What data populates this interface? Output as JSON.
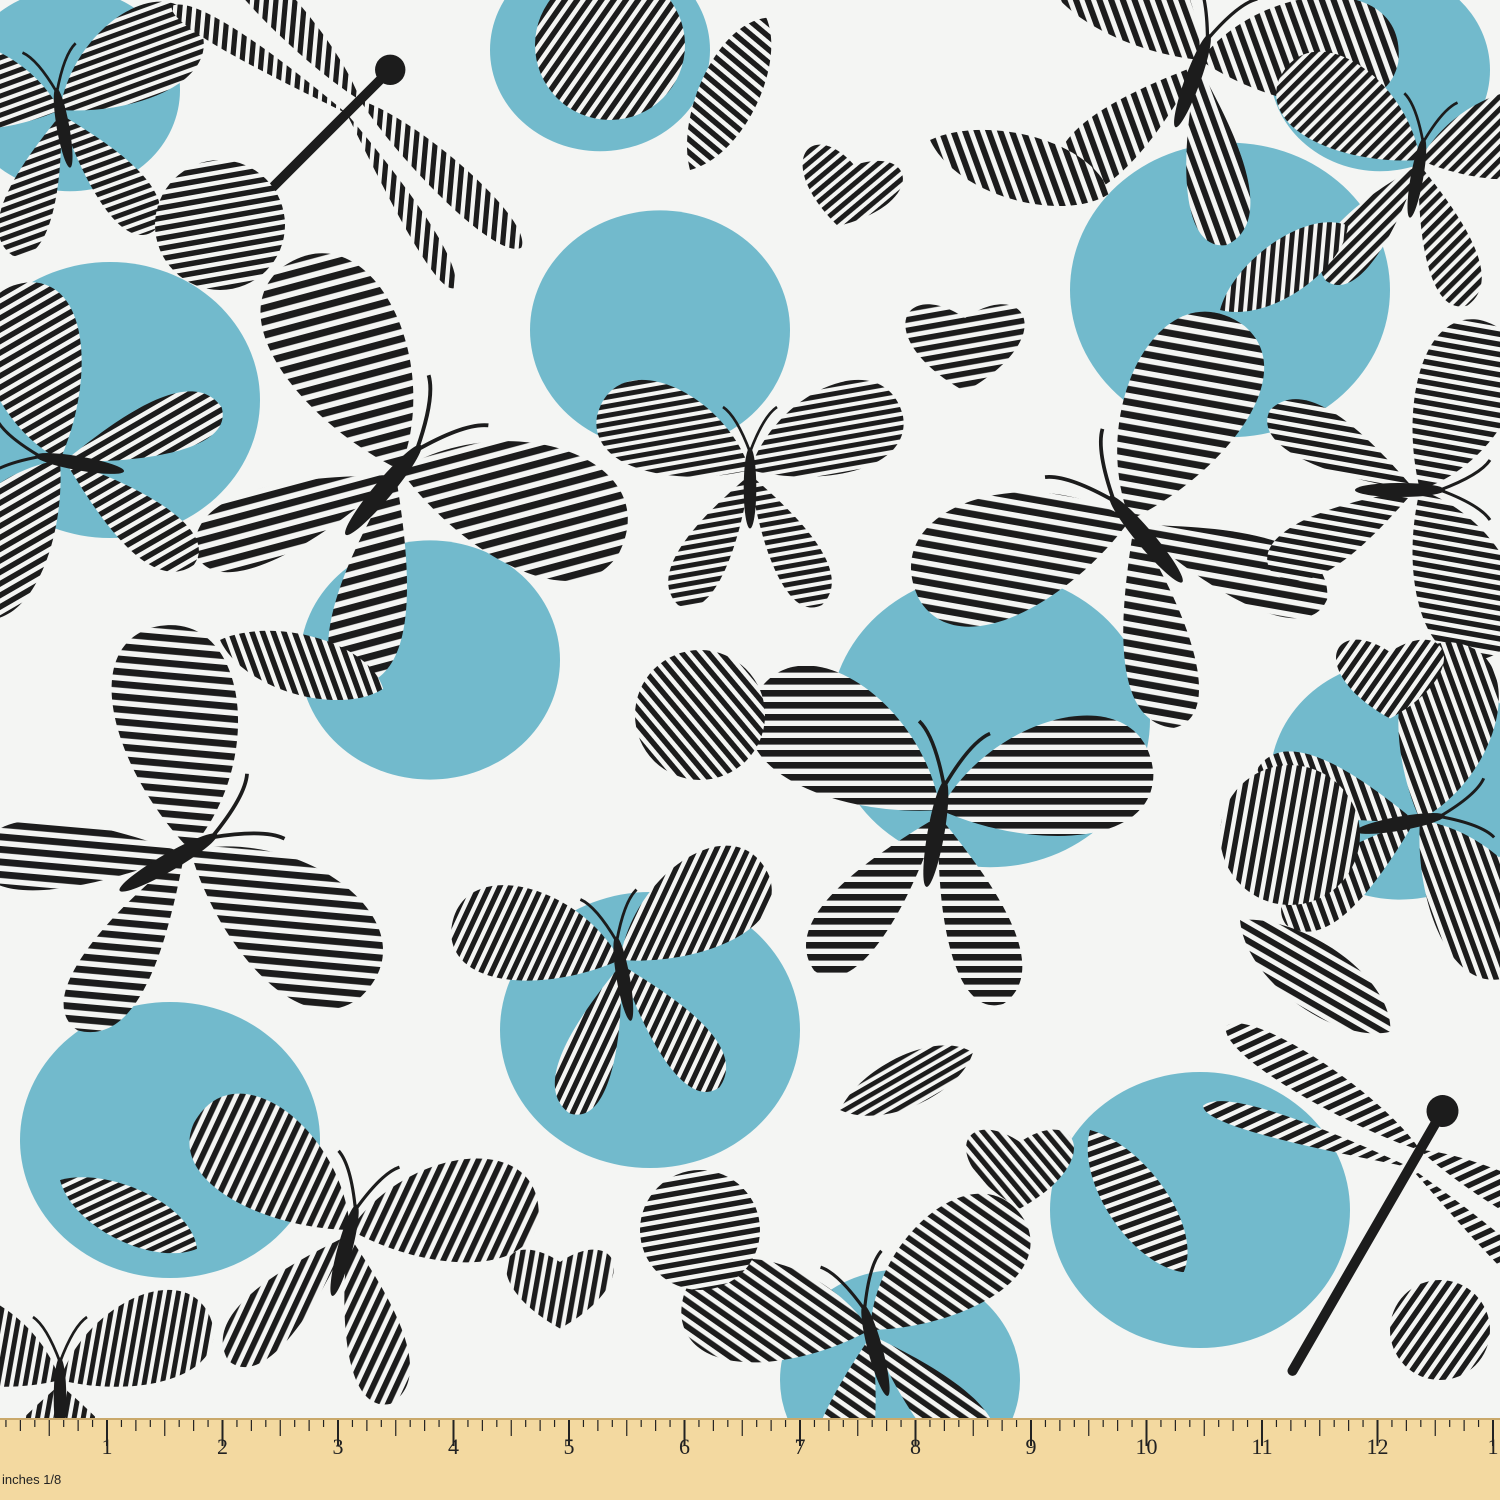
{
  "image": {
    "subject": "fabric swatch",
    "colors": {
      "background": "#f4f5f3",
      "ink": "#1c1c1c",
      "blue": "#6ab6c9",
      "ruler": "#f3d9a0"
    }
  },
  "ruler": {
    "unit_label": "inches 1/8",
    "numbers": [
      "1",
      "2",
      "3",
      "4",
      "5",
      "6",
      "7",
      "8",
      "9",
      "10",
      "11",
      "12",
      "1"
    ]
  }
}
